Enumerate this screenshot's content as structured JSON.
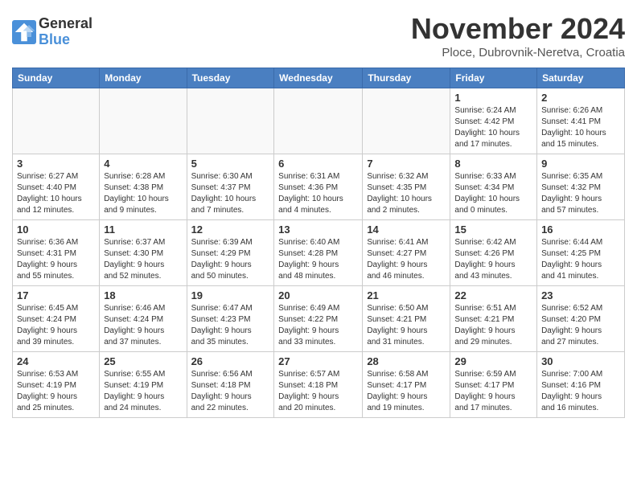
{
  "logo": {
    "general": "General",
    "blue": "Blue"
  },
  "title": "November 2024",
  "subtitle": "Ploce, Dubrovnik-Neretva, Croatia",
  "headers": [
    "Sunday",
    "Monday",
    "Tuesday",
    "Wednesday",
    "Thursday",
    "Friday",
    "Saturday"
  ],
  "weeks": [
    [
      {
        "day": "",
        "info": ""
      },
      {
        "day": "",
        "info": ""
      },
      {
        "day": "",
        "info": ""
      },
      {
        "day": "",
        "info": ""
      },
      {
        "day": "",
        "info": ""
      },
      {
        "day": "1",
        "info": "Sunrise: 6:24 AM\nSunset: 4:42 PM\nDaylight: 10 hours\nand 17 minutes."
      },
      {
        "day": "2",
        "info": "Sunrise: 6:26 AM\nSunset: 4:41 PM\nDaylight: 10 hours\nand 15 minutes."
      }
    ],
    [
      {
        "day": "3",
        "info": "Sunrise: 6:27 AM\nSunset: 4:40 PM\nDaylight: 10 hours\nand 12 minutes."
      },
      {
        "day": "4",
        "info": "Sunrise: 6:28 AM\nSunset: 4:38 PM\nDaylight: 10 hours\nand 9 minutes."
      },
      {
        "day": "5",
        "info": "Sunrise: 6:30 AM\nSunset: 4:37 PM\nDaylight: 10 hours\nand 7 minutes."
      },
      {
        "day": "6",
        "info": "Sunrise: 6:31 AM\nSunset: 4:36 PM\nDaylight: 10 hours\nand 4 minutes."
      },
      {
        "day": "7",
        "info": "Sunrise: 6:32 AM\nSunset: 4:35 PM\nDaylight: 10 hours\nand 2 minutes."
      },
      {
        "day": "8",
        "info": "Sunrise: 6:33 AM\nSunset: 4:34 PM\nDaylight: 10 hours\nand 0 minutes."
      },
      {
        "day": "9",
        "info": "Sunrise: 6:35 AM\nSunset: 4:32 PM\nDaylight: 9 hours\nand 57 minutes."
      }
    ],
    [
      {
        "day": "10",
        "info": "Sunrise: 6:36 AM\nSunset: 4:31 PM\nDaylight: 9 hours\nand 55 minutes."
      },
      {
        "day": "11",
        "info": "Sunrise: 6:37 AM\nSunset: 4:30 PM\nDaylight: 9 hours\nand 52 minutes."
      },
      {
        "day": "12",
        "info": "Sunrise: 6:39 AM\nSunset: 4:29 PM\nDaylight: 9 hours\nand 50 minutes."
      },
      {
        "day": "13",
        "info": "Sunrise: 6:40 AM\nSunset: 4:28 PM\nDaylight: 9 hours\nand 48 minutes."
      },
      {
        "day": "14",
        "info": "Sunrise: 6:41 AM\nSunset: 4:27 PM\nDaylight: 9 hours\nand 46 minutes."
      },
      {
        "day": "15",
        "info": "Sunrise: 6:42 AM\nSunset: 4:26 PM\nDaylight: 9 hours\nand 43 minutes."
      },
      {
        "day": "16",
        "info": "Sunrise: 6:44 AM\nSunset: 4:25 PM\nDaylight: 9 hours\nand 41 minutes."
      }
    ],
    [
      {
        "day": "17",
        "info": "Sunrise: 6:45 AM\nSunset: 4:24 PM\nDaylight: 9 hours\nand 39 minutes."
      },
      {
        "day": "18",
        "info": "Sunrise: 6:46 AM\nSunset: 4:24 PM\nDaylight: 9 hours\nand 37 minutes."
      },
      {
        "day": "19",
        "info": "Sunrise: 6:47 AM\nSunset: 4:23 PM\nDaylight: 9 hours\nand 35 minutes."
      },
      {
        "day": "20",
        "info": "Sunrise: 6:49 AM\nSunset: 4:22 PM\nDaylight: 9 hours\nand 33 minutes."
      },
      {
        "day": "21",
        "info": "Sunrise: 6:50 AM\nSunset: 4:21 PM\nDaylight: 9 hours\nand 31 minutes."
      },
      {
        "day": "22",
        "info": "Sunrise: 6:51 AM\nSunset: 4:21 PM\nDaylight: 9 hours\nand 29 minutes."
      },
      {
        "day": "23",
        "info": "Sunrise: 6:52 AM\nSunset: 4:20 PM\nDaylight: 9 hours\nand 27 minutes."
      }
    ],
    [
      {
        "day": "24",
        "info": "Sunrise: 6:53 AM\nSunset: 4:19 PM\nDaylight: 9 hours\nand 25 minutes."
      },
      {
        "day": "25",
        "info": "Sunrise: 6:55 AM\nSunset: 4:19 PM\nDaylight: 9 hours\nand 24 minutes."
      },
      {
        "day": "26",
        "info": "Sunrise: 6:56 AM\nSunset: 4:18 PM\nDaylight: 9 hours\nand 22 minutes."
      },
      {
        "day": "27",
        "info": "Sunrise: 6:57 AM\nSunset: 4:18 PM\nDaylight: 9 hours\nand 20 minutes."
      },
      {
        "day": "28",
        "info": "Sunrise: 6:58 AM\nSunset: 4:17 PM\nDaylight: 9 hours\nand 19 minutes."
      },
      {
        "day": "29",
        "info": "Sunrise: 6:59 AM\nSunset: 4:17 PM\nDaylight: 9 hours\nand 17 minutes."
      },
      {
        "day": "30",
        "info": "Sunrise: 7:00 AM\nSunset: 4:16 PM\nDaylight: 9 hours\nand 16 minutes."
      }
    ]
  ]
}
